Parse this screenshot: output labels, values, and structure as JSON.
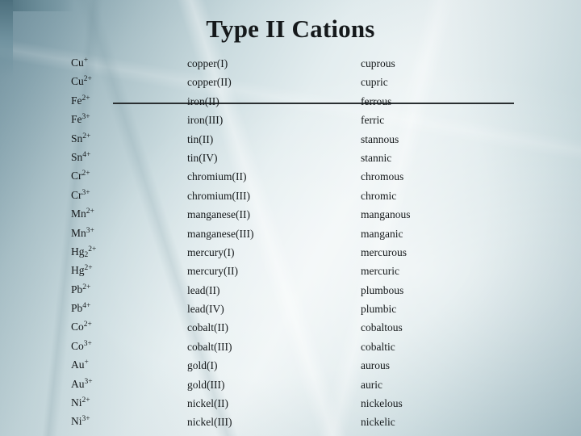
{
  "slide": {
    "title": "Type II Cations",
    "columns": [
      "formula",
      "stock_name",
      "common_name"
    ],
    "rows": [
      {
        "element": "Cu",
        "sub": "",
        "charge": "+",
        "formula_plain": "Cu+",
        "stock": "copper(I)",
        "common": "cuprous"
      },
      {
        "element": "Cu",
        "sub": "",
        "charge": "2+",
        "formula_plain": "Cu2+",
        "stock": "copper(II)",
        "common": "cupric"
      },
      {
        "element": "Fe",
        "sub": "",
        "charge": "2+",
        "formula_plain": "Fe2+",
        "stock": "iron(II)",
        "common": "ferrous"
      },
      {
        "element": "Fe",
        "sub": "",
        "charge": "3+",
        "formula_plain": "Fe3+",
        "stock": "iron(III)",
        "common": "ferric"
      },
      {
        "element": "Sn",
        "sub": "",
        "charge": "2+",
        "formula_plain": "Sn2+",
        "stock": "tin(II)",
        "common": "stannous"
      },
      {
        "element": "Sn",
        "sub": "",
        "charge": "4+",
        "formula_plain": "Sn4+",
        "stock": "tin(IV)",
        "common": "stannic"
      },
      {
        "element": "Cr",
        "sub": "",
        "charge": "2+",
        "formula_plain": "Cr2+",
        "stock": "chromium(II)",
        "common": "chromous"
      },
      {
        "element": "Cr",
        "sub": "",
        "charge": "3+",
        "formula_plain": "Cr3+",
        "stock": "chromium(III)",
        "common": "chromic"
      },
      {
        "element": "Mn",
        "sub": "",
        "charge": "2+",
        "formula_plain": "Mn2+",
        "stock": "manganese(II)",
        "common": "manganous"
      },
      {
        "element": "Mn",
        "sub": "",
        "charge": "3+",
        "formula_plain": "Mn3+",
        "stock": "manganese(III)",
        "common": "manganic"
      },
      {
        "element": "Hg",
        "sub": "2",
        "charge": "2+",
        "formula_plain": "Hg22+",
        "stock": "mercury(I)",
        "common": "mercurous"
      },
      {
        "element": "Hg",
        "sub": "",
        "charge": "2+",
        "formula_plain": "Hg2+",
        "stock": "mercury(II)",
        "common": "mercuric"
      },
      {
        "element": "Pb",
        "sub": "",
        "charge": "2+",
        "formula_plain": "Pb2+",
        "stock": "lead(II)",
        "common": "plumbous"
      },
      {
        "element": "Pb",
        "sub": "",
        "charge": "4+",
        "formula_plain": "Pb4+",
        "stock": "lead(IV)",
        "common": "plumbic"
      },
      {
        "element": "Co",
        "sub": "",
        "charge": "2+",
        "formula_plain": "Co2+",
        "stock": "cobalt(II)",
        "common": "cobaltous"
      },
      {
        "element": "Co",
        "sub": "",
        "charge": "3+",
        "formula_plain": "Co3+",
        "stock": "cobalt(III)",
        "common": "cobaltic"
      },
      {
        "element": "Au",
        "sub": "",
        "charge": "+",
        "formula_plain": "Au+",
        "stock": "gold(I)",
        "common": "aurous"
      },
      {
        "element": "Au",
        "sub": "",
        "charge": "3+",
        "formula_plain": "Au3+",
        "stock": "gold(III)",
        "common": "auric"
      },
      {
        "element": "Ni",
        "sub": "",
        "charge": "2+",
        "formula_plain": "Ni2+",
        "stock": "nickel(II)",
        "common": "nickelous"
      },
      {
        "element": "Ni",
        "sub": "",
        "charge": "3+",
        "formula_plain": "Ni3+",
        "stock": "nickel(III)",
        "common": "nickelic"
      }
    ]
  },
  "theme": {
    "text_color": "#15191b",
    "rule_color": "#2a2f31",
    "bg_light": "#eef4f5",
    "bg_dark": "#6f8e9c"
  }
}
